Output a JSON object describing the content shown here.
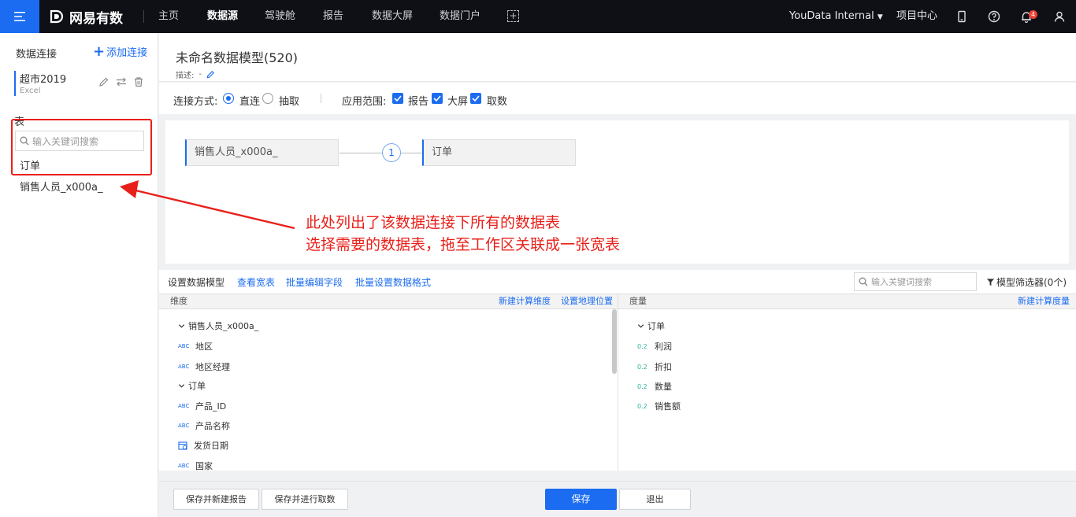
{
  "topbar": {
    "logo_text": "网易有数",
    "nav": [
      {
        "label": "主页",
        "active": false
      },
      {
        "label": "数据源",
        "active": true
      },
      {
        "label": "驾驶舱",
        "active": false
      },
      {
        "label": "报告",
        "active": false
      },
      {
        "label": "数据大屏",
        "active": false
      },
      {
        "label": "数据门户",
        "active": false
      }
    ],
    "org_name": "YouData Internal",
    "project_center": "项目中心",
    "notification_count": "4"
  },
  "sidebar": {
    "title": "数据连接",
    "add_label": "添加连接",
    "connection": {
      "name": "超市2019",
      "type": "Excel"
    },
    "section_label": "表",
    "search_placeholder": "输入关键词搜索",
    "tables": [
      "订单",
      "销售人员_x000a_"
    ]
  },
  "header": {
    "title": "未命名数据模型(520)",
    "desc_label": "描述:",
    "desc_value": "-"
  },
  "options": {
    "connect_label": "连接方式:",
    "connect_direct": "直连",
    "connect_extract": "抽取",
    "scope_label": "应用范围:",
    "scope_items": [
      "报告",
      "大屏",
      "取数"
    ]
  },
  "canvas": {
    "left_table": "销售人员_x000a_",
    "right_table": "订单",
    "link_count": "1"
  },
  "annotation": {
    "line1": "此处列出了该数据连接下所有的数据表",
    "line2": "选择需要的数据表，拖至工作区关联成一张宽表"
  },
  "fields_toolbar": {
    "label": "设置数据模型",
    "links": [
      "查看宽表",
      "批量编辑字段",
      "批量设置数据格式"
    ],
    "search_placeholder": "输入关键词搜索",
    "filter_label": "模型筛选器(0个)"
  },
  "dimensions": {
    "header": "维度",
    "new_calc": "新建计算维度",
    "geo": "设置地理位置",
    "groups": [
      {
        "name": "销售人员_x000a_",
        "fields": [
          {
            "type": "ABC",
            "name": "地区"
          },
          {
            "type": "ABC",
            "name": "地区经理"
          }
        ]
      },
      {
        "name": "订单",
        "fields": [
          {
            "type": "ABC",
            "name": "产品_ID"
          },
          {
            "type": "ABC",
            "name": "产品名称"
          },
          {
            "type": "date",
            "name": "发货日期"
          },
          {
            "type": "ABC",
            "name": "国家"
          }
        ]
      }
    ]
  },
  "measures": {
    "header": "度量",
    "new_calc": "新建计算度量",
    "group": "订单",
    "type_label": "0.2",
    "fields": [
      "利润",
      "折扣",
      "数量",
      "销售额"
    ]
  },
  "footer": {
    "save_new_report": "保存并新建报告",
    "save_fetch": "保存并进行取数",
    "save": "保存",
    "exit": "退出"
  }
}
